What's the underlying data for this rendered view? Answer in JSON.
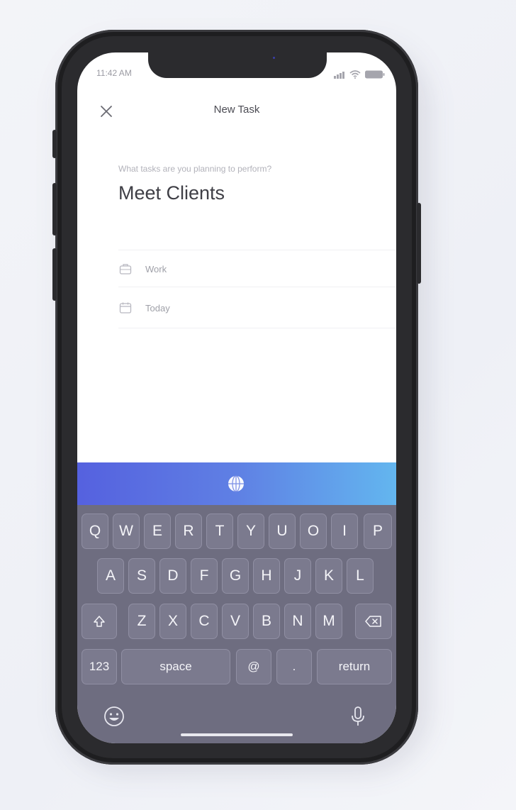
{
  "status_bar": {
    "time": "11:42 AM"
  },
  "header": {
    "title": "New Task",
    "close_icon": "close-icon"
  },
  "form": {
    "prompt": "What tasks are you planning to perform?",
    "task_value": "Meet Clients",
    "fields": [
      {
        "icon": "briefcase-icon",
        "label": "Work"
      },
      {
        "icon": "calendar-icon",
        "label": "Today"
      }
    ]
  },
  "colors": {
    "accent_start": "#5561df",
    "accent_end": "#63b6ef",
    "keyboard_bg": "#6e6d80"
  },
  "keyboard": {
    "row1": [
      "Q",
      "W",
      "E",
      "R",
      "T",
      "Y",
      "U",
      "O",
      "I",
      "P"
    ],
    "row2": [
      "A",
      "S",
      "D",
      "F",
      "G",
      "H",
      "J",
      "K",
      "L"
    ],
    "row3": [
      "Z",
      "X",
      "C",
      "V",
      "B",
      "N",
      "M"
    ],
    "numbers_label": "123",
    "space_label": "space",
    "at_label": "@",
    "period_label": ".",
    "return_label": "return"
  }
}
